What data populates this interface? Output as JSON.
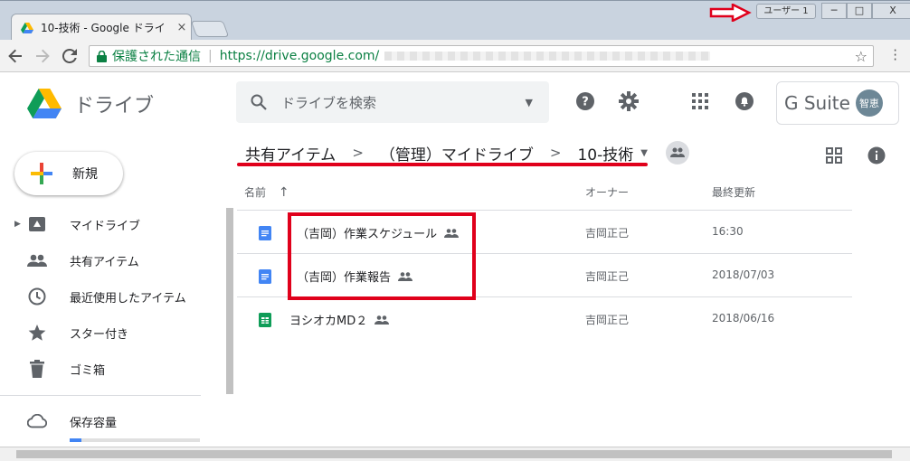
{
  "browser": {
    "tab_title": "10-技術 - Google ドライ",
    "tab_close": "×",
    "user_label": "ユーザー 1",
    "secure_label": "保護された通信",
    "url": "https://drive.google.com/",
    "controls": {
      "minimize": "─",
      "maximize": "□",
      "close": "X"
    }
  },
  "app": {
    "logo_text": "ドライブ",
    "search_placeholder": "ドライブを検索",
    "gsuite_text": "G Suite",
    "avatar_text": "智恵"
  },
  "breadcrumb": {
    "items": [
      "共有アイテム",
      "（管理）マイドライブ",
      "10-技術"
    ],
    "separator": ">"
  },
  "sidebar": {
    "new_label": "新規",
    "items": [
      {
        "label": "マイドライブ",
        "icon": "drive-icon"
      },
      {
        "label": "共有アイテム",
        "icon": "people-icon"
      },
      {
        "label": "最近使用したアイテム",
        "icon": "clock-icon"
      },
      {
        "label": "スター付き",
        "icon": "star-icon"
      },
      {
        "label": "ゴミ箱",
        "icon": "trash-icon"
      }
    ],
    "storage_label": "保存容量",
    "storage_fraction": 0.09
  },
  "list": {
    "columns": {
      "name": "名前",
      "owner": "オーナー",
      "modified": "最終更新"
    },
    "rows": [
      {
        "name": "（吉岡）作業スケジュール",
        "owner": "吉岡正己",
        "modified": "16:30",
        "type": "doc"
      },
      {
        "name": "（吉岡）作業報告",
        "owner": "吉岡正己",
        "modified": "2018/07/03",
        "type": "doc"
      },
      {
        "name": "ヨシオカMD２",
        "owner": "吉岡正己",
        "modified": "2018/06/16",
        "type": "sheet"
      }
    ]
  },
  "colors": {
    "annotation_red": "#e0001b",
    "doc_blue": "#4285f4",
    "sheet_green": "#0f9d58",
    "secure_green": "#0b8043"
  }
}
